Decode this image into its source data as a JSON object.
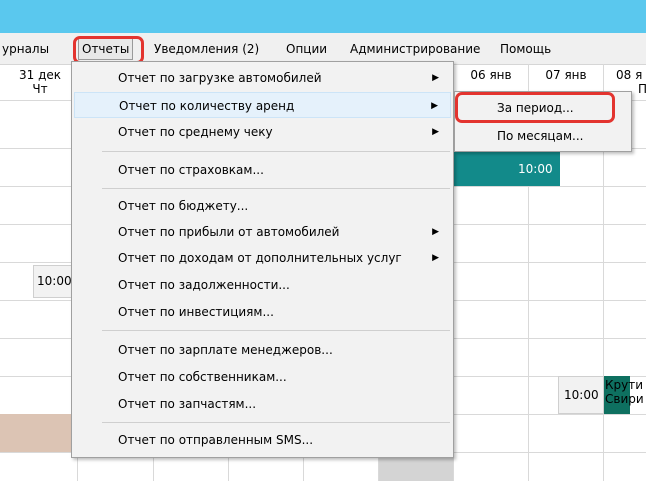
{
  "menubar": {
    "items": [
      {
        "label": "урналы"
      },
      {
        "label": "Отчеты"
      },
      {
        "label": "Уведомления (2)"
      },
      {
        "label": "Опции"
      },
      {
        "label": "Администрирование"
      },
      {
        "label": "Помощь"
      }
    ]
  },
  "calendar": {
    "headers": [
      {
        "date": "31 дек",
        "weekday": "Чт"
      },
      {
        "date": "06 янв",
        "weekday": ""
      },
      {
        "date": "07 янв",
        "weekday": ""
      },
      {
        "date": "08 я",
        "weekday": "Пт"
      }
    ],
    "cells": {
      "time1": "10:00",
      "time2": "10:00",
      "time3": "10:00",
      "booking_text_1": "Крути",
      "booking_text_2": "Свири"
    },
    "colors": {
      "booking": "#128a8a",
      "booking_dark": "#0e7060",
      "past": "#dcc4b4",
      "gray": "#d4d4d4"
    }
  },
  "reports_menu": {
    "items": [
      {
        "label": "Отчет по загрузке автомобилей"
      },
      {
        "label": "Отчет по количеству аренд"
      },
      {
        "label": "Отчет по среднему чеку"
      },
      {
        "label": "Отчет по страховкам..."
      },
      {
        "label": "Отчет по бюджету..."
      },
      {
        "label": "Отчет по прибыли от автомобилей"
      },
      {
        "label": "Отчет по доходам от дополнительных услуг"
      },
      {
        "label": "Отчет по задолженности..."
      },
      {
        "label": "Отчет по инвестициям..."
      },
      {
        "label": "Отчет по зарплате менеджеров..."
      },
      {
        "label": "Отчет по собственникам..."
      },
      {
        "label": "Отчет по запчастям..."
      },
      {
        "label": "Отчет по отправленным SMS..."
      }
    ]
  },
  "submenu": {
    "items": [
      {
        "label": "За период..."
      },
      {
        "label": "По месяцам..."
      }
    ]
  },
  "accent_colors": {
    "titlebar": "#5ac8ee",
    "highlight_ring": "#e3342f"
  }
}
